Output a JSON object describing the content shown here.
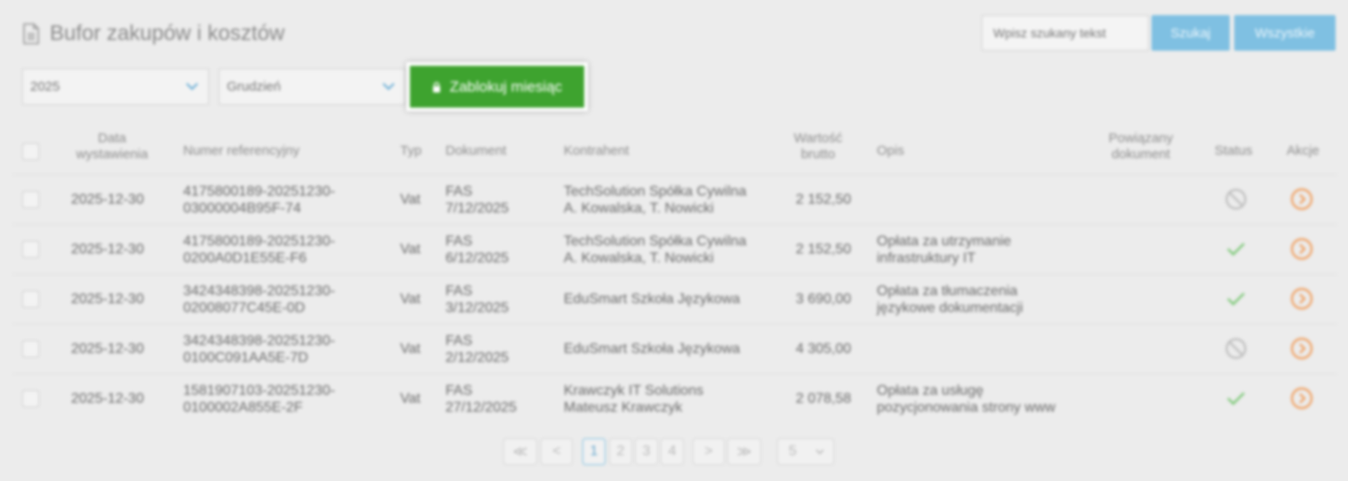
{
  "header": {
    "title": "Bufor zakupów i kosztów",
    "search_placeholder": "Wpisz szukany tekst",
    "search_button": "Szukaj",
    "all_button": "Wszystkie"
  },
  "filters": {
    "year": "2025",
    "month": "Grudzień",
    "lock_button": "Zablokuj miesiąc"
  },
  "table": {
    "headers": {
      "date_line1": "Data",
      "date_line2": "wystawienia",
      "ref": "Numer referencyjny",
      "type": "Typ",
      "document": "Dokument",
      "contractor": "Kontrahent",
      "value_line1": "Wartość",
      "value_line2": "brutto",
      "description": "Opis",
      "related_line1": "Powiązany",
      "related_line2": "dokument",
      "status": "Status",
      "actions": "Akcje"
    },
    "rows": [
      {
        "date": "2025-12-30",
        "ref1": "4175800189-20251230-",
        "ref2": "03000004B95F-74",
        "type": "Vat",
        "doc1": "FAS",
        "doc2": "7/12/2025",
        "con1": "TechSolution Spółka Cywilna",
        "con2": "A. Kowalska, T. Nowicki",
        "value": "2 152,50",
        "desc1": "",
        "desc2": "",
        "status": "blocked"
      },
      {
        "date": "2025-12-30",
        "ref1": "4175800189-20251230-",
        "ref2": "0200A0D1E55E-F6",
        "type": "Vat",
        "doc1": "FAS",
        "doc2": "6/12/2025",
        "con1": "TechSolution Spółka Cywilna",
        "con2": "A. Kowalska, T. Nowicki",
        "value": "2 152,50",
        "desc1": "Opłata za utrzymanie",
        "desc2": "infrastruktury IT",
        "status": "ok"
      },
      {
        "date": "2025-12-30",
        "ref1": "3424348398-20251230-",
        "ref2": "02008077C45E-0D",
        "type": "Vat",
        "doc1": "FAS",
        "doc2": "3/12/2025",
        "con1": "EduSmart Szkoła Językowa",
        "con2": "",
        "value": "3 690,00",
        "desc1": "Opłata za tłumaczenia",
        "desc2": "językowe dokumentacji",
        "status": "ok"
      },
      {
        "date": "2025-12-30",
        "ref1": "3424348398-20251230-",
        "ref2": "0100C091AA5E-7D",
        "type": "Vat",
        "doc1": "FAS",
        "doc2": "2/12/2025",
        "con1": "EduSmart Szkoła Językowa",
        "con2": "",
        "value": "4 305,00",
        "desc1": "",
        "desc2": "",
        "status": "blocked"
      },
      {
        "date": "2025-12-30",
        "ref1": "1581907103-20251230-",
        "ref2": "0100002A855E-2F",
        "type": "Vat",
        "doc1": "FAS",
        "doc2": "27/12/2025",
        "con1": "Krawczyk IT Solutions",
        "con2": "Mateusz Krawczyk",
        "value": "2 078,58",
        "desc1": "Opłata za usługę",
        "desc2": "pozycjonowania strony www",
        "status": "ok"
      }
    ]
  },
  "pagination": {
    "first": "≪",
    "prev": "<",
    "pages": [
      "1",
      "2",
      "3",
      "4"
    ],
    "next": ">",
    "last": "≫",
    "page_size": "5"
  },
  "colors": {
    "accent_blue": "#7fc0e2",
    "lock_green": "#3ea32f",
    "status_ok": "#7fc97a",
    "status_blocked": "#bdbdbd",
    "action_orange": "#f0a468"
  }
}
